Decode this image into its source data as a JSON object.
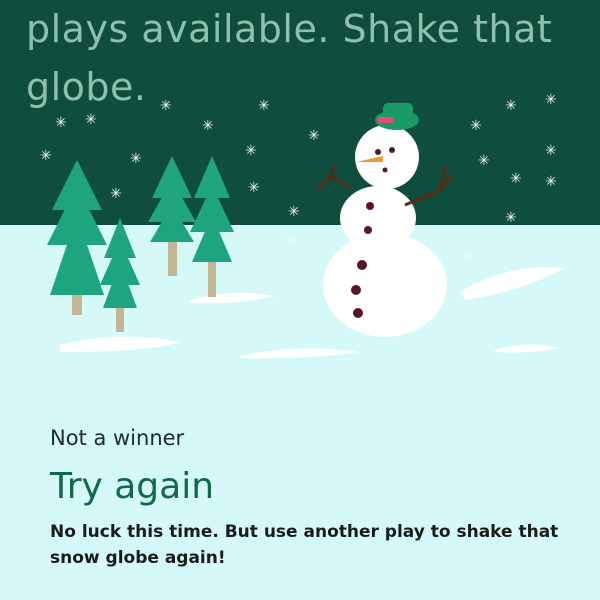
{
  "game": {
    "status_text": "plays available. Shake that globe.",
    "result": {
      "eyebrow": "Not a winner",
      "headline": "Try again",
      "message": "No luck this time. But use another play to shake that snow globe again!"
    }
  },
  "colors": {
    "sky": "#0f4e3c",
    "ground": "#d4f9f8",
    "tree": "#1fa57d",
    "trunk": "#c4b594",
    "accent_text": "#0e6a47",
    "snowman_button": "#5a1430",
    "hat": "#1a9a66",
    "nose": "#f19a2f"
  }
}
